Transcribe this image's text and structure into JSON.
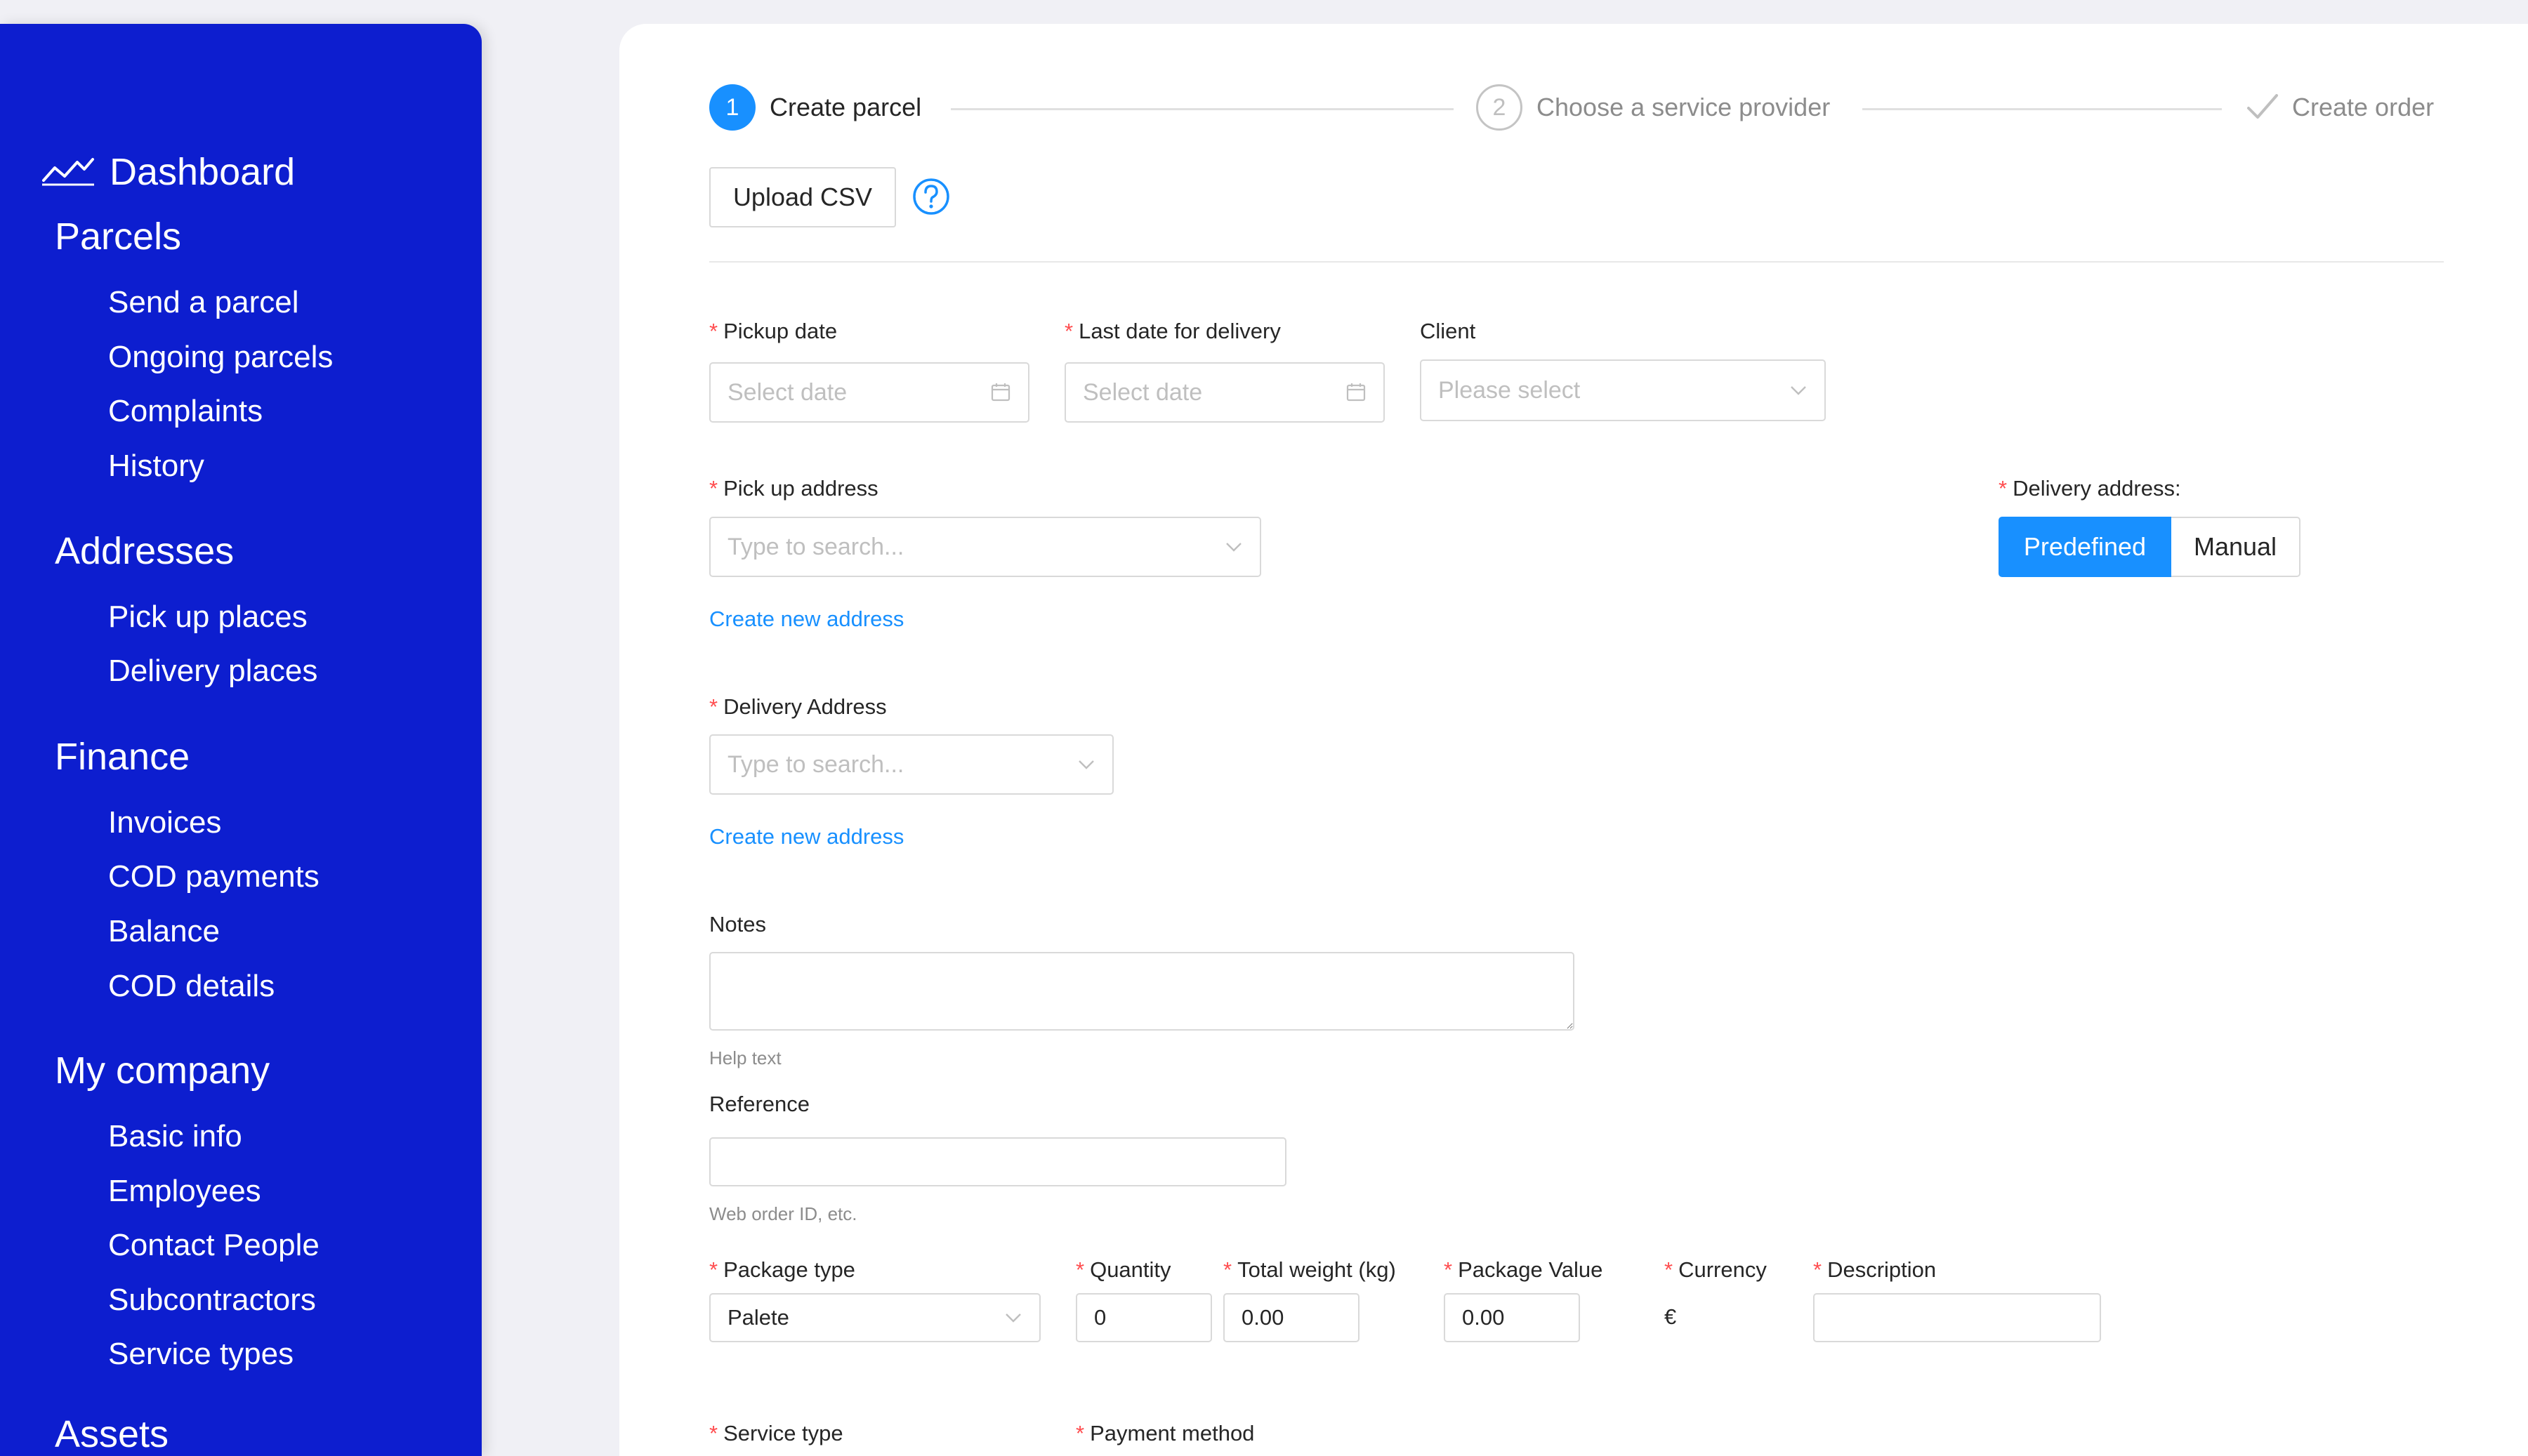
{
  "sidebar": {
    "dashboard": "Dashboard",
    "sections": [
      {
        "title": "Parcels",
        "items": [
          "Send a parcel",
          "Ongoing parcels",
          "Complaints",
          "History"
        ]
      },
      {
        "title": "Addresses",
        "items": [
          "Pick up places",
          "Delivery places"
        ]
      },
      {
        "title": "Finance",
        "items": [
          "Invoices",
          "COD payments",
          "Balance",
          "COD details"
        ]
      },
      {
        "title": "My company",
        "items": [
          "Basic info",
          "Employees",
          "Contact People",
          "Subcontractors",
          "Service types"
        ]
      },
      {
        "title": "Assets"
      }
    ]
  },
  "steps": [
    {
      "number": "1",
      "title": "Create parcel",
      "status": "active"
    },
    {
      "number": "2",
      "title": "Choose a service provider",
      "status": "wait"
    },
    {
      "number": "",
      "title": "Create order",
      "status": "finish"
    }
  ],
  "upload_csv": "Upload CSV",
  "help_icon": "question-circle-icon",
  "form": {
    "pickup_date": {
      "label": "Pickup date",
      "placeholder": "Select date"
    },
    "last_delivery_date": {
      "label": "Last date for delivery",
      "placeholder": "Select date"
    },
    "client": {
      "label": "Client",
      "placeholder": "Please select"
    },
    "pickup_address": {
      "label": "Pick up address",
      "placeholder": "Type to search...",
      "create_link": "Create new address"
    },
    "delivery_address_mode": {
      "label": "Delivery address",
      "colon": ":",
      "options": [
        "Predefined",
        "Manual"
      ],
      "selected": "Predefined"
    },
    "delivery_address": {
      "label": "Delivery Address",
      "placeholder": "Type to search...",
      "create_link": "Create new address"
    },
    "notes": {
      "label": "Notes",
      "help": "Help text"
    },
    "reference": {
      "label": "Reference",
      "help": "Web order ID, etc."
    },
    "package_type": {
      "label": "Package type",
      "value": "Palete"
    },
    "quantity": {
      "label": "Quantity",
      "value": "0"
    },
    "total_weight": {
      "label": "Total weight (kg)",
      "value": "0.00"
    },
    "package_value": {
      "label": "Package Value",
      "value": "0.00"
    },
    "currency": {
      "label": "Currency",
      "value": "€"
    },
    "description": {
      "label": "Description",
      "value": ""
    },
    "service_type": {
      "label": "Service type"
    },
    "payment_method": {
      "label": "Payment method"
    }
  },
  "colors": {
    "sidebar": "#0d1ecf",
    "primary": "#1890ff",
    "required": "#ff4d4f",
    "page_bg": "#f0f0f5"
  }
}
